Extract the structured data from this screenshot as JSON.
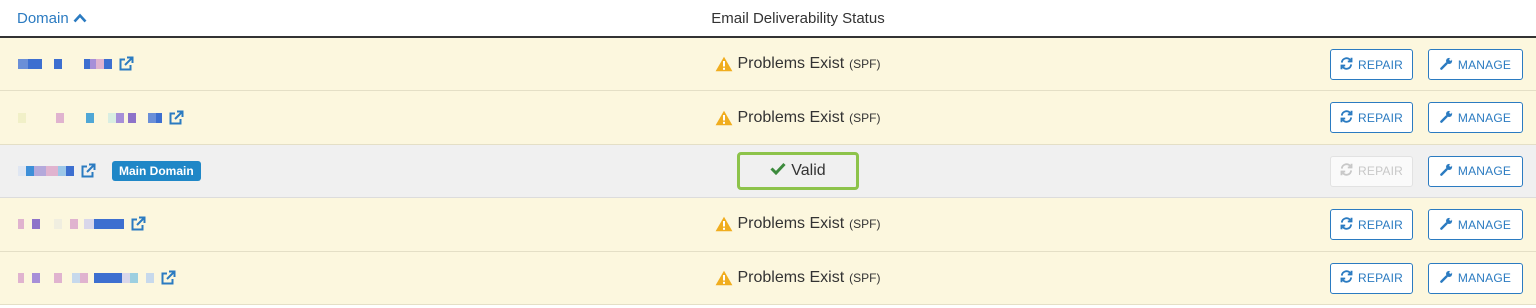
{
  "header": {
    "domain_label": "Domain",
    "status_label": "Email Deliverability Status"
  },
  "rows": [
    {
      "status": "Problems Exist",
      "status_detail": "(SPF)",
      "repair_label": "REPAIR",
      "manage_label": "MANAGE",
      "redaction": [
        [
          "#6a8fd8",
          10
        ],
        [
          "#3d6fd0",
          14
        ],
        [
          "#fcf7de",
          12
        ],
        [
          "#3d6fd0",
          8
        ],
        [
          "#fcf7de",
          22
        ],
        [
          "#3d6fd0",
          6
        ],
        [
          "#a78fd8",
          6
        ],
        [
          "#e0b3cf",
          8
        ],
        [
          "#3d6fd0",
          8
        ]
      ]
    },
    {
      "status": "Problems Exist",
      "status_detail": "(SPF)",
      "repair_label": "REPAIR",
      "manage_label": "MANAGE",
      "redaction": [
        [
          "#f1f0c8",
          8
        ],
        [
          "#fcf7de",
          30
        ],
        [
          "#e0b3cf",
          8
        ],
        [
          "#fcf7de",
          22
        ],
        [
          "#4fa7d6",
          8
        ],
        [
          "#fcf7de",
          14
        ],
        [
          "#d9eee2",
          8
        ],
        [
          "#a78fd8",
          8
        ],
        [
          "#fcf7de",
          4
        ],
        [
          "#8d73c9",
          8
        ],
        [
          "#fcf7de",
          12
        ],
        [
          "#6a8fd8",
          8
        ],
        [
          "#3d6fd0",
          6
        ]
      ]
    },
    {
      "status": "Valid",
      "badge": "Main Domain",
      "repair_label": "REPAIR",
      "manage_label": "MANAGE",
      "redaction": [
        [
          "#dfe6f2",
          8
        ],
        [
          "#3d8fd8",
          8
        ],
        [
          "#b4a9db",
          12
        ],
        [
          "#e0b3cf",
          12
        ],
        [
          "#9cc7e8",
          8
        ],
        [
          "#3d6fd0",
          8
        ]
      ]
    },
    {
      "status": "Problems Exist",
      "status_detail": "(SPF)",
      "repair_label": "REPAIR",
      "manage_label": "MANAGE",
      "redaction": [
        [
          "#e0b3cf",
          6
        ],
        [
          "#fcf7de",
          8
        ],
        [
          "#8d73c9",
          8
        ],
        [
          "#fcf7de",
          14
        ],
        [
          "#f0eee0",
          8
        ],
        [
          "#fcf7de",
          8
        ],
        [
          "#e0b3cf",
          8
        ],
        [
          "#fcf7de",
          6
        ],
        [
          "#d9d7ea",
          10
        ],
        [
          "#3d6fd0",
          30
        ]
      ]
    },
    {
      "status": "Problems Exist",
      "status_detail": "(SPF)",
      "repair_label": "REPAIR",
      "manage_label": "MANAGE",
      "redaction": [
        [
          "#e0b3cf",
          6
        ],
        [
          "#fcf7de",
          8
        ],
        [
          "#a78fd8",
          8
        ],
        [
          "#fcf7de",
          14
        ],
        [
          "#e0b3cf",
          8
        ],
        [
          "#fcf7de",
          10
        ],
        [
          "#c7d9ec",
          8
        ],
        [
          "#e0b3cf",
          8
        ],
        [
          "#fcf7de",
          6
        ],
        [
          "#3d6fd0",
          28
        ],
        [
          "#d9d7ea",
          8
        ],
        [
          "#9ccfe0",
          8
        ],
        [
          "#fcf7de",
          8
        ],
        [
          "#c7d9ec",
          8
        ]
      ]
    }
  ],
  "colors": {
    "link": "#2b7bc1",
    "warning": "#f0ad1e",
    "valid_border": "#8dc34a",
    "valid_check": "#3d8b3d",
    "badge": "#1f87c7",
    "row_problem_bg": "#fcf7de",
    "row_valid_bg": "#f0f0f0"
  },
  "icons": {
    "sort": "chevron-up-icon",
    "external": "external-link-icon",
    "warning": "warning-triangle-icon",
    "valid": "check-icon",
    "repair": "refresh-icon",
    "manage": "wrench-icon"
  }
}
